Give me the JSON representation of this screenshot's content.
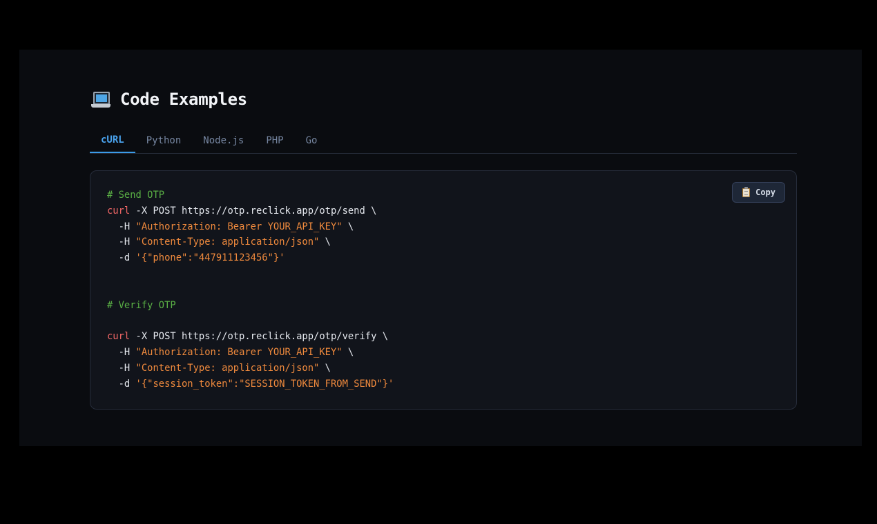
{
  "section": {
    "icon": "laptop-icon",
    "title": "Code Examples"
  },
  "tabs": [
    {
      "label": "cURL",
      "active": true
    },
    {
      "label": "Python",
      "active": false
    },
    {
      "label": "Node.js",
      "active": false
    },
    {
      "label": "PHP",
      "active": false
    },
    {
      "label": "Go",
      "active": false
    }
  ],
  "copy_button": {
    "icon": "clipboard-icon",
    "label": "Copy"
  },
  "code": {
    "send_comment": "# Send OTP",
    "send_cmd": "curl",
    "send_args": " -X POST https://otp.reclick.app/otp/send \\",
    "send_h1_flag": "  -H ",
    "send_h1_val": "\"Authorization: Bearer YOUR_API_KEY\"",
    "send_h1_tail": " \\",
    "send_h2_flag": "  -H ",
    "send_h2_val": "\"Content-Type: application/json\"",
    "send_h2_tail": " \\",
    "send_d_flag": "  -d ",
    "send_d_val": "'{\"phone\":\"447911123456\"}'",
    "verify_comment": "# Verify OTP",
    "verify_cmd": "curl",
    "verify_args": " -X POST https://otp.reclick.app/otp/verify \\",
    "verify_h1_flag": "  -H ",
    "verify_h1_val": "\"Authorization: Bearer YOUR_API_KEY\"",
    "verify_h1_tail": " \\",
    "verify_h2_flag": "  -H ",
    "verify_h2_val": "\"Content-Type: application/json\"",
    "verify_h2_tail": " \\",
    "verify_d_flag": "  -d ",
    "verify_d_val": "'{\"session_token\":\"SESSION_TOKEN_FROM_SEND\"}'"
  },
  "colors": {
    "background": "#0a0c10",
    "accent": "#4aa3ee",
    "comment": "#5ab045",
    "keyword": "#f26767",
    "string": "#f08a3d"
  }
}
